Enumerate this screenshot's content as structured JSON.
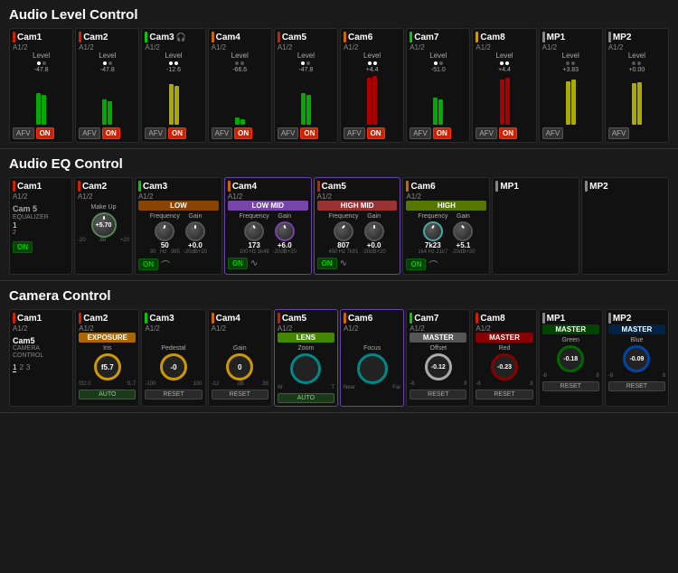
{
  "sections": {
    "audio_level": {
      "title": "Audio Level Control",
      "channels": [
        {
          "name": "Cam1",
          "sub": "A1/2",
          "level": -47.8,
          "meterL": 55,
          "meterR": 50,
          "hasAfv": true,
          "hasOn": true,
          "barColor": "bar-red"
        },
        {
          "name": "Cam2",
          "sub": "A1/2",
          "level": -47.8,
          "meterL": 40,
          "meterR": 38,
          "hasAfv": true,
          "hasOn": true,
          "barColor": "bar-red"
        },
        {
          "name": "Cam3",
          "sub": "A1/2",
          "level": -12.6,
          "meterL": 70,
          "meterR": 68,
          "hasAfv": true,
          "hasOn": true,
          "barColor": "bar-green",
          "headphone": true
        },
        {
          "name": "Cam4",
          "sub": "A1/2",
          "level": -66.6,
          "meterL": 10,
          "meterR": 8,
          "hasAfv": true,
          "hasOn": true,
          "barColor": "bar-orange"
        },
        {
          "name": "Cam5",
          "sub": "A1/2",
          "level": -47.8,
          "meterL": 55,
          "meterR": 50,
          "hasAfv": true,
          "hasOn": true,
          "barColor": "bar-red"
        },
        {
          "name": "Cam6",
          "sub": "A1/2",
          "level": 4.4,
          "meterL": 80,
          "meterR": 82,
          "hasAfv": true,
          "hasOn": true,
          "barColor": "bar-orange"
        },
        {
          "name": "Cam7",
          "sub": "A1/2",
          "level": -51.0,
          "meterL": 45,
          "meterR": 42,
          "hasAfv": true,
          "hasOn": true,
          "barColor": "bar-green"
        },
        {
          "name": "Cam8",
          "sub": "A1/2",
          "level": 4.4,
          "meterL": 78,
          "meterR": 80,
          "hasAfv": true,
          "hasOn": true,
          "barColor": "bar-amber"
        },
        {
          "name": "MP1",
          "sub": "A1/2",
          "level": 3.83,
          "meterL": 75,
          "meterR": 77,
          "hasAfv": true,
          "hasOn": false,
          "barColor": "bar-gray"
        },
        {
          "name": "MP2",
          "sub": "A1/2",
          "level": 0.0,
          "meterL": 72,
          "meterR": 74,
          "hasAfv": true,
          "hasOn": false,
          "barColor": "bar-gray"
        }
      ]
    },
    "audio_eq": {
      "title": "Audio EQ Control",
      "channels": [
        {
          "name": "Cam1",
          "sub": "A1/2",
          "barColor": "bar-red",
          "type": "cam-select"
        },
        {
          "name": "Cam2",
          "sub": "A1/2",
          "barColor": "bar-red",
          "type": "makeup"
        },
        {
          "name": "Cam3",
          "sub": "A1/2",
          "barColor": "bar-green",
          "type": "low"
        },
        {
          "name": "Cam4",
          "sub": "A1/2",
          "barColor": "bar-orange",
          "type": "lowmid"
        },
        {
          "name": "Cam5",
          "sub": "A1/2",
          "barColor": "bar-red",
          "type": "highmid",
          "highlighted": true
        },
        {
          "name": "Cam6",
          "sub": "A1/2",
          "barColor": "bar-orange",
          "type": "high",
          "highlighted": true
        }
      ]
    },
    "camera_control": {
      "title": "Camera Control",
      "channels": [
        {
          "name": "Cam1",
          "sub": "A1/2",
          "barColor": "bar-red",
          "type": "cam-select"
        },
        {
          "name": "Cam2",
          "sub": "A1/2",
          "barColor": "bar-red",
          "type": "exposure"
        },
        {
          "name": "Cam3",
          "sub": "A1/2",
          "barColor": "bar-green",
          "type": "exposure-gain"
        },
        {
          "name": "Cam4",
          "sub": "A1/2",
          "barColor": "bar-orange",
          "type": "exposure-gain2"
        },
        {
          "name": "Cam5",
          "sub": "A1/2",
          "barColor": "bar-red",
          "type": "lens",
          "highlighted": true
        },
        {
          "name": "Cam6",
          "sub": "A1/2",
          "barColor": "bar-orange",
          "type": "lens2",
          "highlighted": true
        },
        {
          "name": "Cam7",
          "sub": "A1/2",
          "barColor": "bar-green",
          "type": "master-offset"
        },
        {
          "name": "Cam8",
          "sub": "A1/2",
          "barColor": "bar-amber",
          "type": "master-red"
        },
        {
          "name": "MP1",
          "barColor": "bar-gray",
          "type": "master-green"
        },
        {
          "name": "MP2",
          "barColor": "bar-gray",
          "type": "master-blue"
        }
      ]
    }
  },
  "labels": {
    "afv": "AFV",
    "on": "ON",
    "level": "Level",
    "low": "LOW",
    "low_mid": "LOW MID",
    "high_mid": "HIGH MID",
    "high": "HIGH",
    "frequency": "Frequency",
    "gain": "Gain",
    "makeup": "Make Up",
    "exposure": "EXPOSURE",
    "lens": "LENS",
    "master": "MASTER",
    "iris": "Iris",
    "pedestal": "Pedestal",
    "gain_label": "Gain",
    "zoom": "Zoom",
    "focus": "Focus",
    "offset": "Offset",
    "red": "Red",
    "green": "Green",
    "blue": "Blue",
    "auto": "AUTO",
    "reset": "RESET",
    "cam5_label": "Cam 5",
    "equalizer": "EQUALIZER",
    "on_btn": "ON",
    "camera_control": "CAMERA CONTROL",
    "eq_values": {
      "makeup": "+5.70",
      "low_freq": "50",
      "low_gain": "+0.0",
      "lowmid_freq": "173",
      "lowmid_gain": "+6.0",
      "highmid_freq": "807",
      "highmid_gain": "+0.0",
      "high_freq": "7k23",
      "high_gain": "+5.1"
    },
    "cam_values": {
      "iris": "f5.7",
      "pedestal": "-0",
      "gain": "0",
      "offset": "-0.12",
      "red": "-0.23",
      "green": "-0.18",
      "blue": "-0.09"
    },
    "cam5_cam_name": "Cam5",
    "master_red_label": "Master Red 023"
  }
}
